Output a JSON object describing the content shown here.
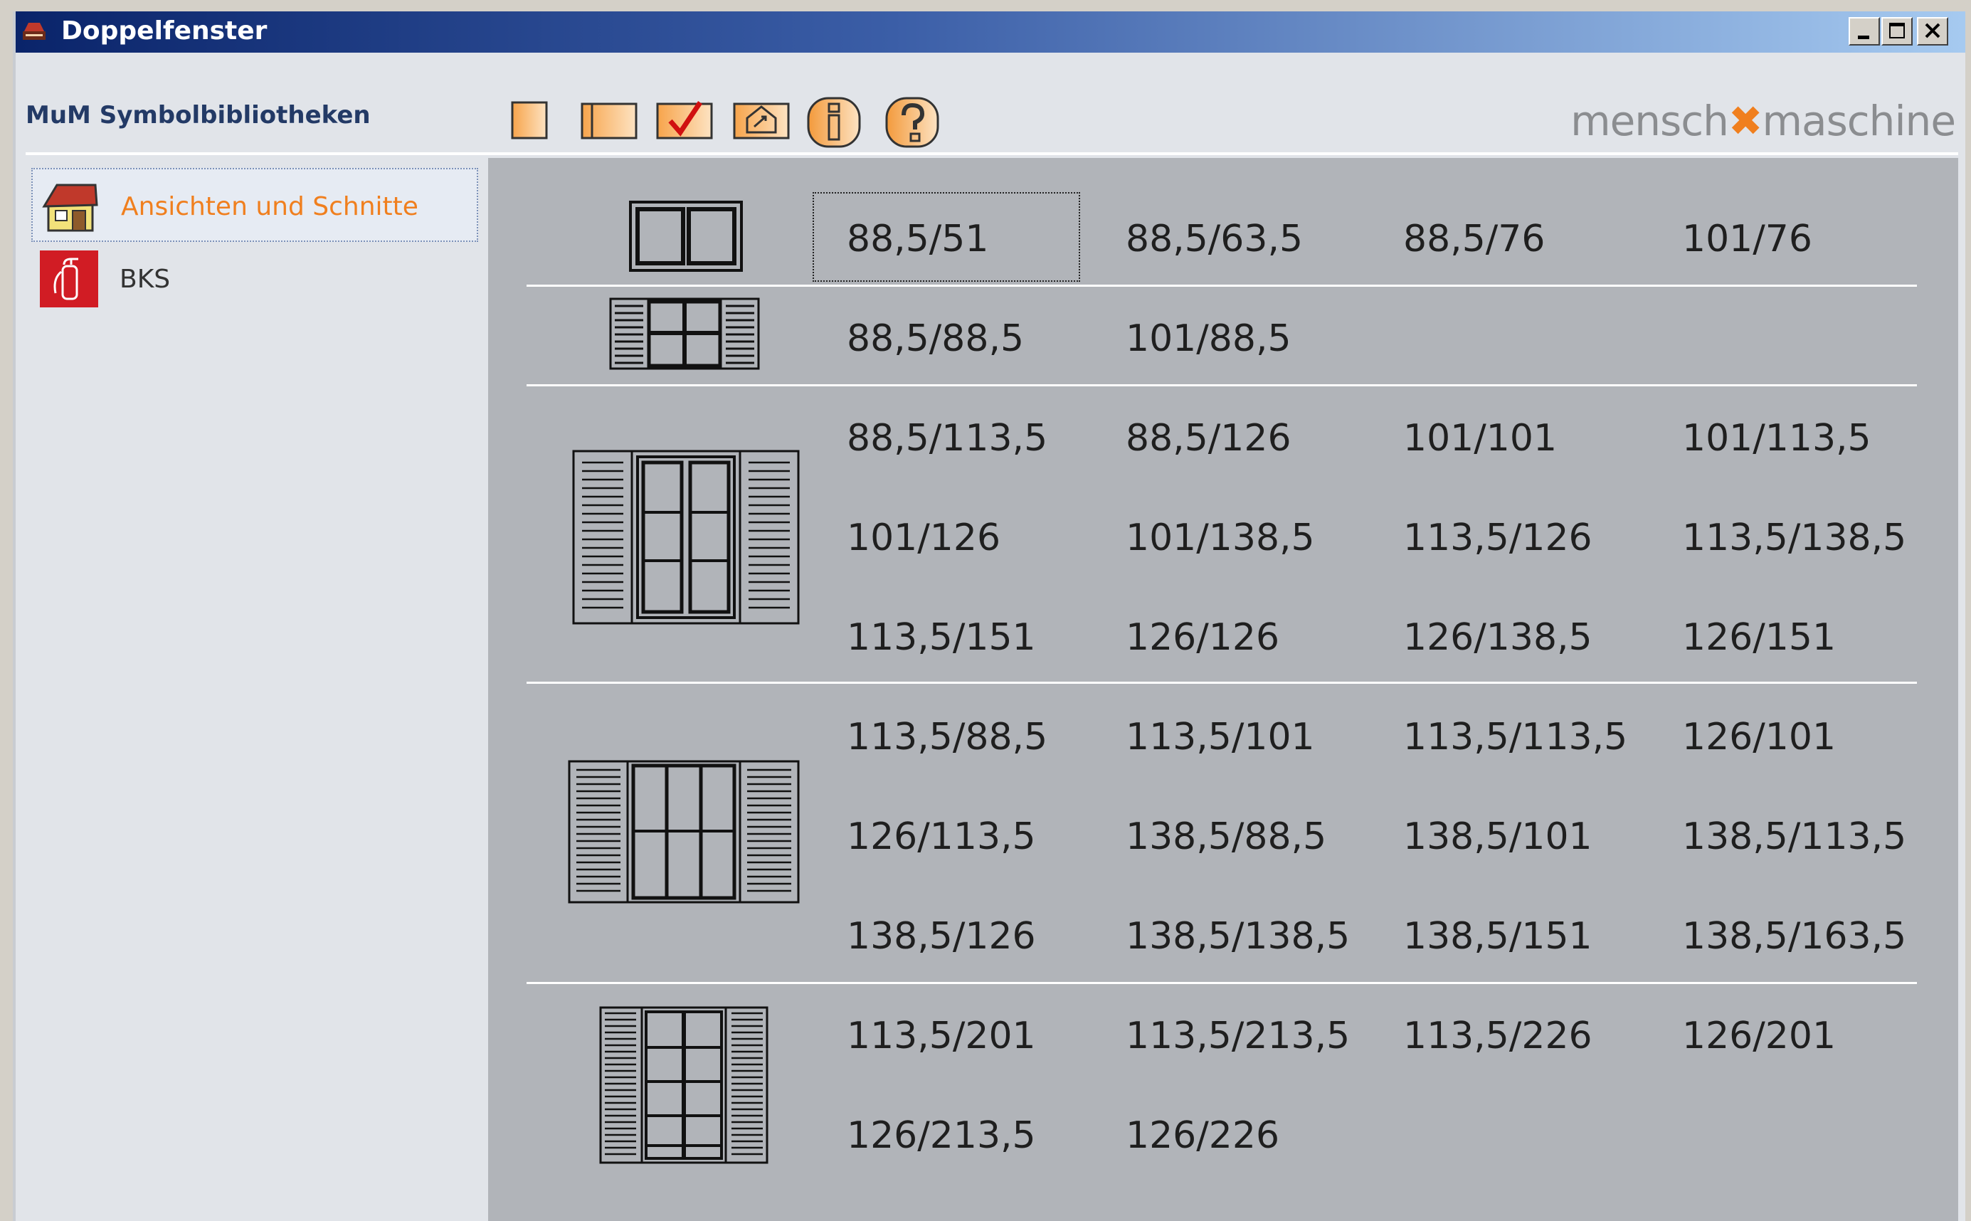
{
  "window": {
    "title": "Doppelfenster"
  },
  "toolbar": {
    "library_label": "MuM Symbolbibliotheken",
    "brand_left": "mensch",
    "brand_right": "maschine",
    "buttons": [
      "blank-page-icon",
      "page-panel-icon",
      "checkmark-icon",
      "house-arrow-icon",
      "info-icon",
      "help-icon"
    ]
  },
  "sidebar": {
    "items": [
      {
        "label": "Ansichten und Schnitte",
        "icon": "house-icon",
        "selected": true,
        "color": "#f07f1e"
      },
      {
        "label": "BKS",
        "icon": "fire-extinguisher-icon",
        "selected": false,
        "color": "#333333"
      }
    ]
  },
  "grid": {
    "rows": [
      {
        "symbol": "double-window-icon",
        "cells": [
          [
            "88,5/51",
            "88,5/63,5",
            "88,5/76",
            "101/76"
          ]
        ]
      },
      {
        "symbol": "double-window-shutters-small-icon",
        "cells": [
          [
            "88,5/88,5",
            "101/88,5"
          ]
        ]
      },
      {
        "symbol": "double-window-shutters-tall-icon",
        "cells": [
          [
            "88,5/113,5",
            "88,5/126",
            "101/101",
            "101/113,5"
          ],
          [
            "101/126",
            "101/138,5",
            "113,5/126",
            "113,5/138,5"
          ],
          [
            "113,5/151",
            "126/126",
            "126/138,5",
            "126/151"
          ]
        ]
      },
      {
        "symbol": "triple-window-shutters-icon",
        "cells": [
          [
            "113,5/88,5",
            "113,5/101",
            "113,5/113,5",
            "126/101"
          ],
          [
            "126/113,5",
            "138,5/88,5",
            "138,5/101",
            "138,5/113,5"
          ],
          [
            "138,5/126",
            "138,5/138,5",
            "138,5/151",
            "138,5/163,5"
          ]
        ]
      },
      {
        "symbol": "french-door-shutters-icon",
        "cells": [
          [
            "113,5/201",
            "113,5/213,5",
            "113,5/226",
            "126/201"
          ],
          [
            "126/213,5",
            "126/226"
          ]
        ]
      }
    ]
  }
}
